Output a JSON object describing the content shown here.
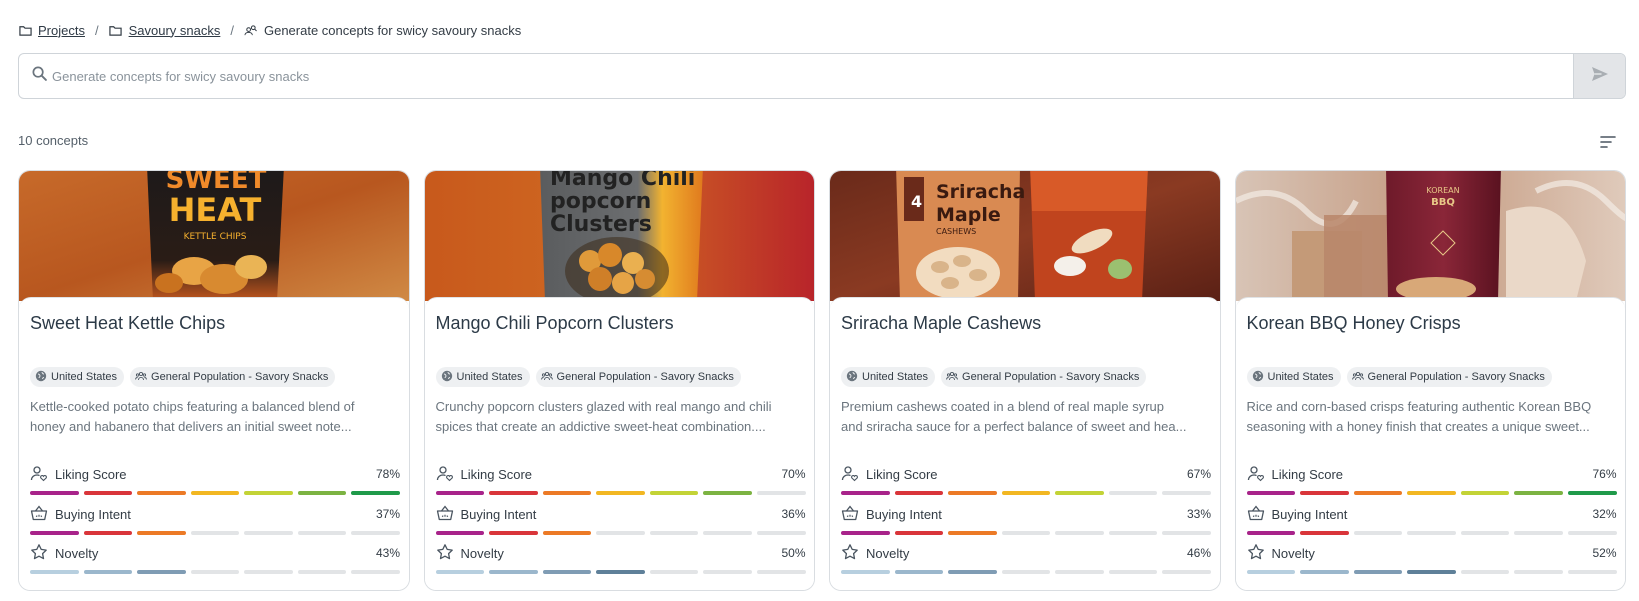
{
  "breadcrumb": {
    "items": [
      {
        "label": "Projects",
        "icon": "folder-icon"
      },
      {
        "label": "Savoury snacks",
        "icon": "folder-icon"
      },
      {
        "label": "Generate concepts for swicy savoury snacks",
        "icon": "search-concepts-icon"
      }
    ],
    "separator": "/"
  },
  "search": {
    "placeholder": "Generate concepts for swicy savoury snacks",
    "value": "",
    "icon": "search-icon",
    "send_icon": "send-icon"
  },
  "results": {
    "count_label": "10 concepts",
    "sort_icon": "sort-icon"
  },
  "colors": {
    "liking": [
      "#a8238a",
      "#d9353a",
      "#ec7a26",
      "#f2b722",
      "#c3d336",
      "#7cb342",
      "#1f9a4a"
    ],
    "novelty": [
      "#b7cfdf",
      "#9bb7cc",
      "#7f9cb4",
      "#5f8099"
    ],
    "empty": "#e2e4e6"
  },
  "metric_labels": {
    "liking": "Liking Score",
    "buying": "Buying Intent",
    "novelty": "Novelty"
  },
  "cards": [
    {
      "title": "Sweet Heat Kettle Chips",
      "tags": [
        "United States",
        "General Population - Savory Snacks"
      ],
      "desc1": "Kettle-cooked potato chips featuring a balanced blend of",
      "desc2": "honey and habanero that delivers an initial sweet note...",
      "image_text": {
        "line1": "SWEET",
        "line2": "HEAT",
        "line3": "KETTLE CHIPS"
      },
      "liking": "78%",
      "liking_segments": 7,
      "buying": "37%",
      "buying_segments": 3,
      "novelty": "43%",
      "novelty_segments": 3
    },
    {
      "title": "Mango Chili Popcorn Clusters",
      "tags": [
        "United States",
        "General Population - Savory Snacks"
      ],
      "desc1": "Crunchy popcorn clusters glazed with real mango and chili",
      "desc2": "spices that create an addictive sweet-heat combination....",
      "image_text": {
        "line1": "Mango Chili",
        "line2": "popcorn",
        "line3": "Clusters"
      },
      "liking": "70%",
      "liking_segments": 6,
      "buying": "36%",
      "buying_segments": 3,
      "novelty": "50%",
      "novelty_segments": 4
    },
    {
      "title": "Sriracha Maple Cashews",
      "tags": [
        "United States",
        "General Population - Savory Snacks"
      ],
      "desc1": "Premium cashews coated in a blend of real maple syrup",
      "desc2": "and sriracha sauce for a perfect balance of sweet and hea...",
      "image_text": {
        "line1": "Sriracha",
        "line2": "Maple",
        "line3": "CASHEWS"
      },
      "liking": "67%",
      "liking_segments": 5,
      "buying": "33%",
      "buying_segments": 3,
      "novelty": "46%",
      "novelty_segments": 3
    },
    {
      "title": "Korean BBQ Honey Crisps",
      "tags": [
        "United States",
        "General Population - Savory Snacks"
      ],
      "desc1": "Rice and corn-based crisps featuring authentic Korean BBQ",
      "desc2": "seasoning with a honey finish that creates a unique sweet...",
      "image_text": {
        "line1": "KOREAN",
        "line2": "BBQ",
        "line3": ""
      },
      "liking": "76%",
      "liking_segments": 7,
      "buying": "32%",
      "buying_segments": 2,
      "novelty": "52%",
      "novelty_segments": 4
    }
  ]
}
